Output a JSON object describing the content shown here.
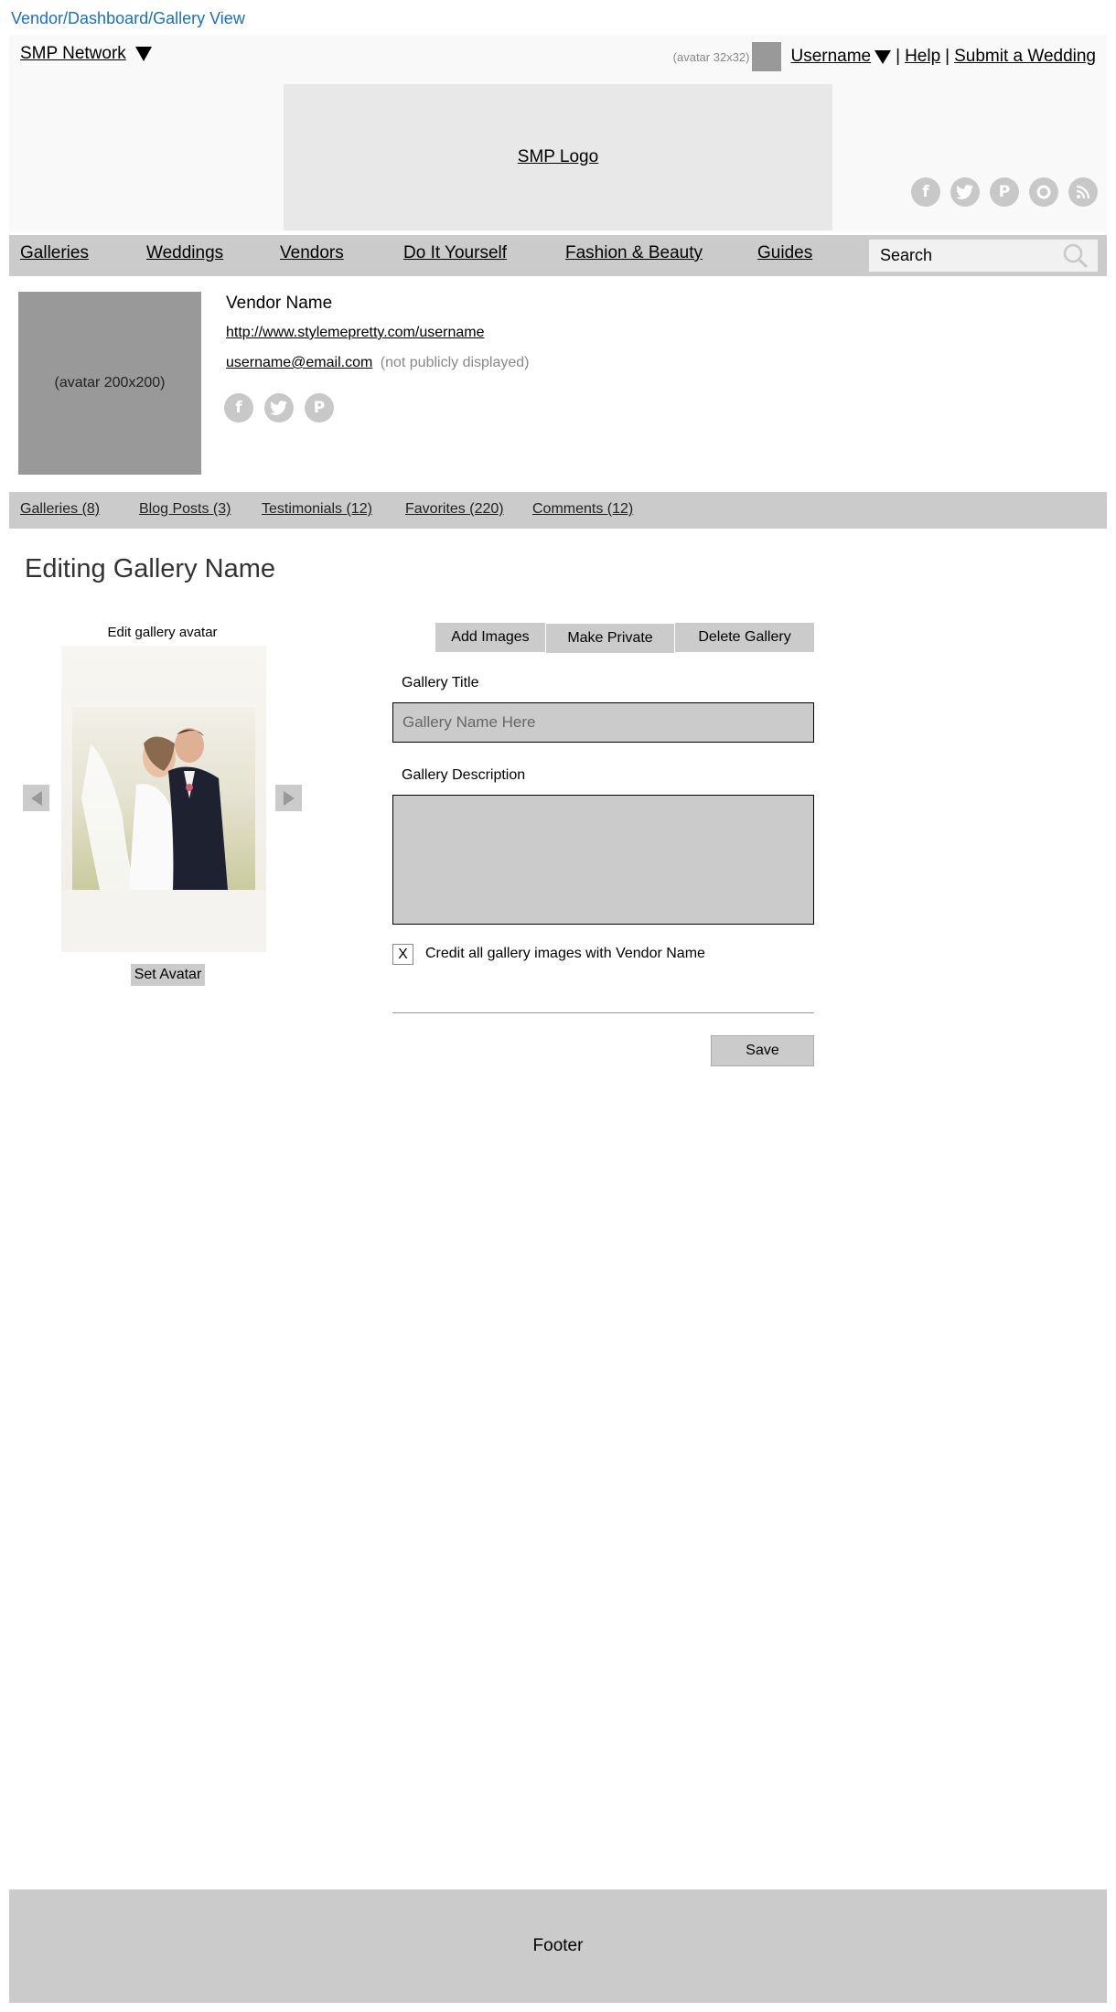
{
  "breadcrumb": "Vendor/Dashboard/Gallery View",
  "header": {
    "network_label": "SMP Network",
    "avatar_note": "(avatar 32x32)",
    "username": "Username",
    "help": "Help",
    "submit": "Submit a Wedding",
    "separator": "|",
    "logo": "SMP Logo",
    "social_icons": [
      "facebook-icon",
      "twitter-icon",
      "pinterest-icon",
      "instagram-icon",
      "rss-icon"
    ]
  },
  "nav": {
    "items": [
      "Galleries",
      "Weddings",
      "Vendors",
      "Do It Yourself",
      "Fashion & Beauty",
      "Guides"
    ],
    "search_placeholder": "Search"
  },
  "profile": {
    "avatar_label": "(avatar 200x200)",
    "vendor_name": "Vendor Name",
    "url": "http://www.stylemepretty.com/username",
    "email": "username@email.com",
    "email_note": "(not publicly displayed)",
    "social_icons": [
      "facebook-icon",
      "twitter-icon",
      "pinterest-icon"
    ]
  },
  "tabs": [
    "Galleries (8)",
    "Blog Posts (3)",
    "Testimonials (12)",
    "Favorites (220)",
    "Comments (12)"
  ],
  "editor": {
    "title": "Editing Gallery Name",
    "avatar_label": "Edit gallery avatar",
    "set_avatar": "Set Avatar",
    "actions": [
      "Add Images",
      "Make Private",
      "Delete Gallery"
    ],
    "gallery_title_label": "Gallery Title",
    "gallery_title_placeholder": "Gallery Name Here",
    "gallery_desc_label": "Gallery Description",
    "credit_checkbox_mark": "X",
    "credit_label": "Credit all gallery images with Vendor Name",
    "save": "Save"
  },
  "footer": "Footer",
  "colors": {
    "breadcrumb": "#1a6fc0",
    "nav_bg": "#cbcbcb",
    "header_bg": "#f9f9f9",
    "logo_bg": "#e8e8e8",
    "avatar_bg": "#999999"
  }
}
